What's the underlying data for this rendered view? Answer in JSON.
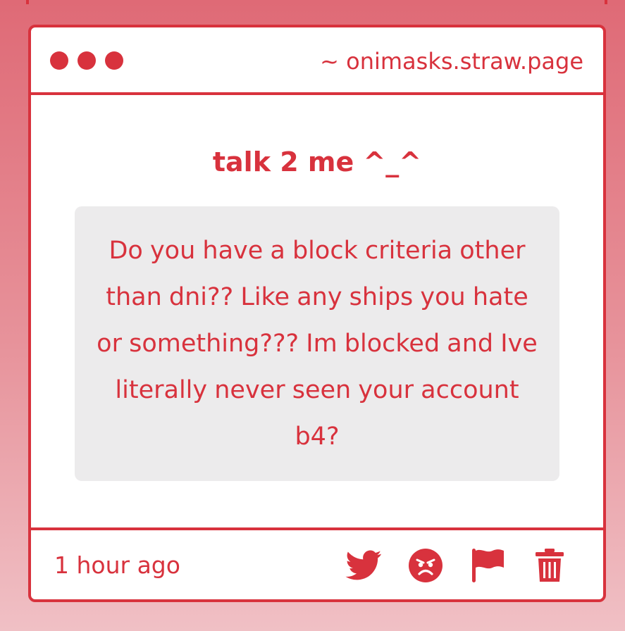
{
  "colors": {
    "accent": "#d8323d",
    "message_bg": "#ecebec",
    "card_bg": "#ffffff"
  },
  "window": {
    "dots_icon": "three-dots",
    "site_url": "~ onimasks.straw.page"
  },
  "prompt": {
    "title": "talk 2 me ^_^"
  },
  "message": {
    "text": "Do you have a block criteria other than dni?? Like any ships you hate or something??? Im blocked and Ive literally never seen your account b4?"
  },
  "footer": {
    "timestamp": "1 hour ago",
    "actions": [
      {
        "icon": "twitter-bird-icon"
      },
      {
        "icon": "angry-face-icon"
      },
      {
        "icon": "flag-icon"
      },
      {
        "icon": "trash-icon"
      }
    ]
  }
}
